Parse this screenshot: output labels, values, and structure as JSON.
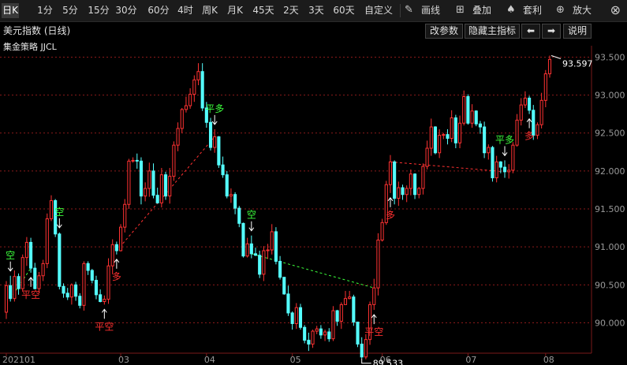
{
  "toolbar": {
    "timeframes": [
      {
        "label": "日K",
        "active": true
      },
      {
        "label": "1分"
      },
      {
        "label": "5分"
      },
      {
        "label": "15分"
      },
      {
        "label": "30分"
      },
      {
        "label": "60分"
      },
      {
        "label": "4时"
      },
      {
        "label": "周K"
      },
      {
        "label": "月K"
      },
      {
        "label": "45天"
      },
      {
        "label": "2天"
      },
      {
        "label": "3天"
      },
      {
        "label": "60天"
      },
      {
        "label": "自定义"
      }
    ],
    "tools": [
      {
        "label": "画线",
        "icon": "pencil-icon"
      },
      {
        "label": "叠加",
        "icon": "stack-icon"
      },
      {
        "label": "套利",
        "icon": "arbitrage-icon"
      },
      {
        "label": "放大",
        "icon": "zoom-icon"
      }
    ],
    "close_icon": "close-icon"
  },
  "header": {
    "title": "美元指数 (日线)",
    "strategy": "集金策略 JJCL",
    "buttons": [
      "改参数",
      "隐藏主指标"
    ],
    "arrows": [
      "left-arrow-icon",
      "right-arrow-icon"
    ],
    "help": "说明"
  },
  "colors": {
    "up": "#ff3232",
    "down": "#54ffff",
    "background": "#000000",
    "grid": "#8b1a1a",
    "buy": "#ff3030",
    "sell": "#3cff3c",
    "axis": "#9a9a9a"
  },
  "chart_data": {
    "type": "candlestick",
    "ylim": [
      89.6,
      93.65
    ],
    "y_ticks": [
      "93.500",
      "93.000",
      "92.500",
      "92.000",
      "91.500",
      "91.000",
      "90.500",
      "90.000"
    ],
    "x_ticks": [
      "202101",
      "03",
      "04",
      "05",
      "06",
      "07",
      "08"
    ],
    "max_label": "93.597",
    "min_label": "89.533",
    "signals": [
      {
        "text": "空",
        "type": "sell",
        "i": 1
      },
      {
        "text": "平空",
        "type": "buy",
        "i": 6
      },
      {
        "text": "空",
        "type": "sell",
        "i": 13
      },
      {
        "text": "平空",
        "type": "buy",
        "i": 24
      },
      {
        "text": "多",
        "type": "buy",
        "i": 27
      },
      {
        "text": "平多",
        "type": "sell",
        "i": 51
      },
      {
        "text": "空",
        "type": "sell",
        "i": 60
      },
      {
        "text": "平空",
        "type": "buy",
        "i": 90
      },
      {
        "text": "多",
        "type": "buy",
        "i": 94
      },
      {
        "text": "平多",
        "type": "sell",
        "i": 122
      },
      {
        "text": "多",
        "type": "buy",
        "i": 128
      }
    ],
    "candles": [
      [
        90.14,
        90.49,
        90.05,
        90.55
      ],
      [
        90.49,
        90.32,
        90.28,
        90.62
      ],
      [
        90.32,
        90.61,
        90.28,
        90.69
      ],
      [
        90.61,
        90.45,
        90.37,
        90.65
      ],
      [
        90.45,
        90.86,
        90.41,
        90.9
      ],
      [
        90.86,
        91.06,
        90.75,
        91.13
      ],
      [
        91.06,
        90.72,
        90.66,
        91.12
      ],
      [
        90.72,
        90.45,
        90.44,
        90.79
      ],
      [
        90.45,
        90.62,
        90.39,
        90.67
      ],
      [
        90.62,
        90.78,
        90.55,
        90.83
      ],
      [
        90.78,
        91.37,
        90.72,
        91.44
      ],
      [
        91.37,
        91.61,
        91.34,
        91.68
      ],
      [
        91.61,
        91.17,
        91.13,
        91.63
      ],
      [
        91.17,
        90.48,
        90.44,
        91.19
      ],
      [
        90.48,
        90.39,
        90.33,
        90.52
      ],
      [
        90.39,
        90.34,
        90.3,
        90.46
      ],
      [
        90.34,
        90.5,
        90.24,
        90.52
      ],
      [
        90.5,
        90.35,
        90.29,
        90.54
      ],
      [
        90.35,
        90.23,
        90.19,
        90.39
      ],
      [
        90.23,
        90.78,
        90.16,
        90.81
      ],
      [
        90.78,
        90.69,
        90.63,
        90.81
      ],
      [
        90.69,
        90.56,
        90.52,
        90.71
      ],
      [
        90.56,
        90.37,
        90.31,
        90.62
      ],
      [
        90.37,
        90.28,
        90.27,
        90.44
      ],
      [
        90.28,
        90.31,
        90.24,
        90.36
      ],
      [
        90.31,
        90.75,
        90.25,
        90.85
      ],
      [
        90.75,
        91.03,
        90.64,
        91.1
      ],
      [
        91.03,
        90.95,
        90.9,
        91.07
      ],
      [
        90.95,
        91.26,
        90.94,
        91.3
      ],
      [
        91.26,
        91.56,
        91.19,
        91.63
      ],
      [
        91.56,
        92.13,
        91.5,
        92.16
      ],
      [
        92.13,
        92.14,
        92.11,
        92.18
      ],
      [
        92.14,
        92.13,
        92.03,
        92.23
      ],
      [
        92.13,
        91.67,
        91.56,
        92.18
      ],
      [
        91.67,
        91.77,
        91.6,
        91.85
      ],
      [
        91.77,
        92.0,
        91.66,
        92.11
      ],
      [
        92.0,
        91.68,
        91.64,
        92.1
      ],
      [
        91.68,
        91.58,
        91.57,
        91.78
      ],
      [
        91.58,
        91.95,
        91.52,
        92.04
      ],
      [
        91.95,
        91.67,
        91.62,
        91.99
      ],
      [
        91.67,
        91.93,
        91.57,
        92.04
      ],
      [
        91.93,
        92.34,
        91.87,
        92.39
      ],
      [
        92.34,
        92.56,
        92.26,
        92.64
      ],
      [
        92.56,
        92.81,
        92.5,
        92.83
      ],
      [
        92.81,
        92.86,
        92.77,
        92.98
      ],
      [
        92.86,
        93.01,
        92.82,
        93.09
      ],
      [
        93.01,
        93.2,
        92.91,
        93.26
      ],
      [
        93.2,
        93.31,
        93.13,
        93.42
      ],
      [
        93.31,
        92.83,
        92.79,
        93.42
      ],
      [
        92.83,
        92.64,
        92.57,
        92.91
      ],
      [
        92.64,
        92.31,
        92.27,
        92.7
      ],
      [
        92.31,
        92.45,
        92.24,
        92.55
      ],
      [
        92.45,
        92.08,
        92.04,
        92.46
      ],
      [
        92.08,
        91.95,
        91.91,
        92.19
      ],
      [
        91.95,
        91.67,
        91.64,
        92.0
      ],
      [
        91.67,
        91.69,
        91.58,
        91.77
      ],
      [
        91.69,
        91.51,
        91.43,
        91.72
      ],
      [
        91.51,
        91.31,
        91.26,
        91.54
      ],
      [
        91.31,
        90.88,
        90.86,
        91.32
      ],
      [
        90.88,
        91.04,
        90.86,
        91.12
      ],
      [
        91.04,
        90.91,
        90.85,
        91.15
      ],
      [
        90.91,
        90.89,
        90.88,
        90.99
      ],
      [
        90.89,
        90.64,
        90.59,
        90.95
      ],
      [
        90.64,
        90.95,
        90.55,
        91.01
      ],
      [
        90.95,
        90.96,
        90.84,
        91.04
      ],
      [
        90.96,
        91.2,
        90.9,
        91.3
      ],
      [
        91.2,
        90.81,
        90.77,
        91.26
      ],
      [
        90.81,
        90.6,
        90.57,
        90.88
      ],
      [
        90.6,
        90.38,
        90.37,
        90.6
      ],
      [
        90.38,
        90.13,
        90.09,
        90.49
      ],
      [
        90.13,
        89.99,
        89.91,
        90.15
      ],
      [
        89.99,
        90.2,
        89.92,
        90.26
      ],
      [
        90.2,
        89.94,
        89.91,
        90.25
      ],
      [
        89.94,
        89.77,
        89.73,
        89.97
      ],
      [
        89.77,
        89.72,
        89.63,
        89.87
      ],
      [
        89.72,
        89.89,
        89.67,
        89.91
      ],
      [
        89.89,
        89.92,
        89.85,
        89.96
      ],
      [
        89.92,
        89.84,
        89.79,
        89.97
      ],
      [
        89.84,
        89.88,
        89.76,
        89.91
      ],
      [
        89.88,
        89.79,
        89.75,
        89.93
      ],
      [
        89.79,
        90.16,
        89.76,
        90.22
      ],
      [
        90.16,
        90.02,
        89.96,
        90.17
      ],
      [
        90.02,
        90.24,
        89.92,
        90.27
      ],
      [
        90.24,
        90.32,
        90.24,
        90.42
      ],
      [
        90.32,
        90.34,
        90.31,
        90.42
      ],
      [
        90.34,
        90.01,
        89.96,
        90.37
      ],
      [
        90.01,
        89.72,
        89.68,
        90.01
      ],
      [
        89.72,
        89.55,
        89.53,
        89.81
      ],
      [
        89.55,
        89.78,
        89.52,
        89.85
      ],
      [
        89.78,
        90.24,
        89.71,
        90.28
      ],
      [
        90.24,
        90.46,
        90.17,
        90.58
      ],
      [
        90.46,
        91.09,
        90.36,
        91.18
      ],
      [
        91.09,
        91.32,
        91.07,
        91.37
      ],
      [
        91.32,
        91.82,
        91.29,
        91.87
      ],
      [
        91.82,
        92.12,
        91.71,
        92.21
      ],
      [
        92.12,
        91.64,
        91.56,
        92.14
      ],
      [
        91.64,
        91.78,
        91.54,
        91.86
      ],
      [
        91.78,
        91.69,
        91.62,
        91.82
      ],
      [
        91.69,
        91.77,
        91.59,
        91.81
      ],
      [
        91.77,
        91.96,
        91.68,
        92.02
      ],
      [
        91.96,
        91.69,
        91.63,
        91.97
      ],
      [
        91.69,
        91.77,
        91.64,
        91.79
      ],
      [
        91.77,
        92.06,
        91.69,
        92.1
      ],
      [
        92.06,
        92.3,
        92.02,
        92.4
      ],
      [
        92.3,
        92.58,
        92.2,
        92.69
      ],
      [
        92.58,
        92.24,
        92.22,
        92.59
      ],
      [
        92.24,
        92.47,
        92.17,
        92.55
      ],
      [
        92.47,
        92.48,
        92.42,
        92.5
      ],
      [
        92.48,
        92.43,
        92.35,
        92.55
      ],
      [
        92.43,
        92.7,
        92.38,
        92.8
      ],
      [
        92.7,
        92.37,
        92.3,
        92.74
      ],
      [
        92.37,
        92.63,
        92.3,
        92.73
      ],
      [
        92.63,
        92.98,
        92.6,
        93.06
      ],
      [
        92.98,
        92.63,
        92.61,
        93.01
      ],
      [
        92.63,
        92.79,
        92.57,
        92.88
      ],
      [
        92.79,
        92.62,
        92.59,
        92.8
      ],
      [
        92.62,
        92.58,
        92.49,
        92.66
      ],
      [
        92.58,
        92.24,
        92.17,
        92.65
      ],
      [
        92.24,
        92.31,
        92.15,
        92.35
      ],
      [
        92.31,
        91.91,
        91.86,
        92.33
      ],
      [
        91.91,
        92.12,
        91.85,
        92.2
      ],
      [
        92.12,
        92.05,
        91.97,
        92.13
      ],
      [
        92.05,
        91.99,
        91.91,
        92.14
      ],
      [
        91.99,
        92.01,
        91.9,
        92.09
      ],
      [
        92.01,
        92.34,
        91.97,
        92.38
      ],
      [
        92.34,
        92.67,
        92.32,
        92.75
      ],
      [
        92.67,
        92.87,
        92.6,
        92.96
      ],
      [
        92.87,
        92.96,
        92.83,
        93.05
      ],
      [
        92.96,
        92.8,
        92.75,
        92.99
      ],
      [
        92.8,
        92.47,
        92.41,
        92.87
      ],
      [
        92.47,
        92.61,
        92.42,
        92.64
      ],
      [
        92.61,
        92.93,
        92.56,
        93.03
      ],
      [
        92.93,
        93.28,
        92.84,
        93.33
      ],
      [
        93.28,
        93.47,
        93.23,
        93.52
      ]
    ]
  }
}
